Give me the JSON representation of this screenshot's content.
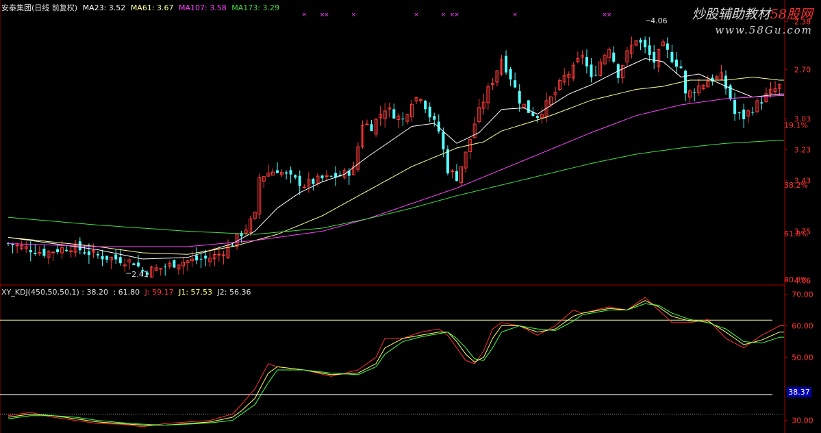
{
  "main_header": {
    "name": "安泰集团(日线 前复权)",
    "ma23": "MA23: 3.52",
    "ma61": "MA61: 3.67",
    "ma107": "MA107: 3.58",
    "ma173": "MA173: 3.29"
  },
  "ind_header": {
    "name": "XY_KDJ(450,50,50,1)",
    "v1": ": 38.20",
    "v2": ": 61.80",
    "j": "J: 59.17",
    "j1": "J1: 57.53",
    "j2": "J2: 56.36"
  },
  "watermark": {
    "line1_a": "炒股辅助教材",
    "line1_b": "58股网",
    "line2": "www.58Gu.com"
  },
  "colors": {
    "up": "#ff3b3b",
    "down": "#54ffff",
    "ma23": "#ffffff",
    "ma61": "#ffff99",
    "ma107": "#ff44ff",
    "ma173": "#44dd44",
    "axis": "#aa0000",
    "axis_text": "#ff3333",
    "k_j": "#ff3030",
    "k_j1": "#ffff66",
    "k_j2": "#44ff44"
  },
  "chart_data": [
    {
      "type": "candlestick",
      "name": "安泰集团(日线 前复权)",
      "y_axis_labels": [
        "4.06",
        "3.75",
        "3.43",
        "3.23",
        "3.03",
        "2.70",
        "2.38"
      ],
      "pct_labels": [
        "80.9%",
        "61.8%",
        "38.2%",
        "19.1%"
      ],
      "price_annotations": {
        "high": "4.06",
        "low": "2.41"
      },
      "ylim": [
        2.36,
        4.12
      ],
      "price_levels": [
        2.38,
        2.7,
        3.03,
        3.23,
        3.43,
        3.75,
        4.06
      ],
      "pct_levels": [
        2.41,
        2.725,
        3.04,
        3.43,
        3.75
      ],
      "close_path": [
        [
          0,
          2.62
        ],
        [
          8,
          2.56
        ],
        [
          14,
          2.6
        ],
        [
          20,
          2.54
        ],
        [
          28,
          2.5
        ],
        [
          30,
          2.44
        ],
        [
          34,
          2.46
        ],
        [
          38,
          2.5
        ],
        [
          44,
          2.52
        ],
        [
          47,
          2.55
        ],
        [
          50,
          2.62
        ],
        [
          53,
          2.72
        ],
        [
          55,
          2.8
        ],
        [
          56,
          3.05
        ],
        [
          58,
          3.08
        ],
        [
          60,
          3.1
        ],
        [
          62,
          3.06
        ],
        [
          66,
          3.0
        ],
        [
          70,
          3.04
        ],
        [
          74,
          3.06
        ],
        [
          77,
          3.1
        ],
        [
          79,
          3.4
        ],
        [
          81,
          3.38
        ],
        [
          84,
          3.5
        ],
        [
          88,
          3.42
        ],
        [
          90,
          3.55
        ],
        [
          92,
          3.58
        ],
        [
          94,
          3.45
        ],
        [
          96,
          3.35
        ],
        [
          98,
          3.1
        ],
        [
          100,
          3.05
        ],
        [
          102,
          3.2
        ],
        [
          104,
          3.4
        ],
        [
          106,
          3.55
        ],
        [
          108,
          3.68
        ],
        [
          110,
          3.82
        ],
        [
          112,
          3.7
        ],
        [
          114,
          3.55
        ],
        [
          116,
          3.48
        ],
        [
          118,
          3.45
        ],
        [
          120,
          3.52
        ],
        [
          122,
          3.6
        ],
        [
          124,
          3.7
        ],
        [
          126,
          3.75
        ],
        [
          128,
          3.85
        ],
        [
          130,
          3.68
        ],
        [
          132,
          3.8
        ],
        [
          134,
          3.9
        ],
        [
          136,
          3.72
        ],
        [
          138,
          3.85
        ],
        [
          140,
          3.95
        ],
        [
          142,
          3.88
        ],
        [
          144,
          3.8
        ],
        [
          146,
          3.9
        ],
        [
          148,
          3.82
        ],
        [
          150,
          3.76
        ],
        [
          151,
          3.58
        ],
        [
          153,
          3.62
        ],
        [
          156,
          3.68
        ],
        [
          159,
          3.7
        ],
        [
          161,
          3.56
        ],
        [
          162,
          3.46
        ],
        [
          164,
          3.44
        ],
        [
          166,
          3.5
        ],
        [
          168,
          3.55
        ],
        [
          170,
          3.6
        ],
        [
          172,
          3.64
        ]
      ],
      "ma_paths": {
        "ma23": [
          [
            0,
            2.66
          ],
          [
            10,
            2.62
          ],
          [
            20,
            2.58
          ],
          [
            30,
            2.52
          ],
          [
            40,
            2.53
          ],
          [
            50,
            2.62
          ],
          [
            55,
            2.7
          ],
          [
            60,
            2.85
          ],
          [
            65,
            2.95
          ],
          [
            70,
            3.02
          ],
          [
            75,
            3.07
          ],
          [
            80,
            3.18
          ],
          [
            90,
            3.38
          ],
          [
            95,
            3.4
          ],
          [
            100,
            3.27
          ],
          [
            105,
            3.34
          ],
          [
            110,
            3.49
          ],
          [
            115,
            3.5
          ],
          [
            118,
            3.46
          ],
          [
            125,
            3.59
          ],
          [
            130,
            3.65
          ],
          [
            136,
            3.74
          ],
          [
            142,
            3.82
          ],
          [
            146,
            3.8
          ],
          [
            150,
            3.7
          ],
          [
            154,
            3.72
          ],
          [
            160,
            3.64
          ],
          [
            166,
            3.57
          ],
          [
            172,
            3.59
          ]
        ],
        "ma61": [
          [
            0,
            2.66
          ],
          [
            20,
            2.6
          ],
          [
            30,
            2.56
          ],
          [
            40,
            2.55
          ],
          [
            50,
            2.6
          ],
          [
            60,
            2.68
          ],
          [
            70,
            2.8
          ],
          [
            80,
            2.96
          ],
          [
            90,
            3.12
          ],
          [
            100,
            3.24
          ],
          [
            106,
            3.28
          ],
          [
            110,
            3.35
          ],
          [
            120,
            3.44
          ],
          [
            130,
            3.55
          ],
          [
            140,
            3.62
          ],
          [
            146,
            3.64
          ],
          [
            152,
            3.68
          ],
          [
            160,
            3.68
          ],
          [
            166,
            3.7
          ],
          [
            172,
            3.68
          ]
        ],
        "ma107": [
          [
            0,
            2.62
          ],
          [
            20,
            2.6
          ],
          [
            40,
            2.6
          ],
          [
            55,
            2.64
          ],
          [
            70,
            2.7
          ],
          [
            80,
            2.78
          ],
          [
            90,
            2.88
          ],
          [
            100,
            2.98
          ],
          [
            110,
            3.1
          ],
          [
            120,
            3.22
          ],
          [
            130,
            3.34
          ],
          [
            140,
            3.45
          ],
          [
            150,
            3.52
          ],
          [
            160,
            3.56
          ],
          [
            172,
            3.58
          ]
        ],
        "ma173": [
          [
            0,
            2.79
          ],
          [
            20,
            2.74
          ],
          [
            40,
            2.7
          ],
          [
            55,
            2.68
          ],
          [
            70,
            2.72
          ],
          [
            80,
            2.78
          ],
          [
            90,
            2.85
          ],
          [
            100,
            2.93
          ],
          [
            110,
            3.0
          ],
          [
            120,
            3.07
          ],
          [
            130,
            3.14
          ],
          [
            140,
            3.2
          ],
          [
            150,
            3.24
          ],
          [
            160,
            3.27
          ],
          [
            172,
            3.29
          ]
        ]
      },
      "signal_marks_x": [
        66,
        70,
        71,
        77,
        91,
        97,
        99,
        100,
        113,
        133,
        134
      ]
    },
    {
      "type": "line",
      "name": "XY_KDJ(450,50,50,1)",
      "y_axis_labels": [
        "70.00",
        "60.00",
        "50.00",
        "30.00"
      ],
      "ylim": [
        26,
        72.5
      ],
      "y_levels": [
        70,
        60,
        50,
        30
      ],
      "hlines": [
        38.2,
        61.8,
        32.0
      ],
      "current_value_label": "38.37",
      "series": [
        {
          "name": "J",
          "points": [
            [
              0,
              31.5
            ],
            [
              5,
              32.5
            ],
            [
              10,
              31
            ],
            [
              15,
              30
            ],
            [
              20,
              29
            ],
            [
              25,
              28.8
            ],
            [
              30,
              28
            ],
            [
              35,
              29
            ],
            [
              40,
              29.5
            ],
            [
              45,
              30
            ],
            [
              50,
              32
            ],
            [
              52,
              35
            ],
            [
              55,
              40
            ],
            [
              58,
              48
            ],
            [
              60,
              47
            ],
            [
              66,
              46
            ],
            [
              72,
              44
            ],
            [
              78,
              46
            ],
            [
              82,
              50
            ],
            [
              84,
              56
            ],
            [
              88,
              56
            ],
            [
              92,
              58
            ],
            [
              96,
              59
            ],
            [
              98,
              57
            ],
            [
              100,
              53
            ],
            [
              102,
              49
            ],
            [
              104,
              48
            ],
            [
              106,
              52
            ],
            [
              108,
              59
            ],
            [
              110,
              61
            ],
            [
              114,
              60
            ],
            [
              118,
              57
            ],
            [
              122,
              60
            ],
            [
              126,
              65
            ],
            [
              128,
              64
            ],
            [
              134,
              66
            ],
            [
              138,
              65
            ],
            [
              142,
              69
            ],
            [
              145,
              65
            ],
            [
              148,
              61
            ],
            [
              152,
              61
            ],
            [
              156,
              62
            ],
            [
              160,
              56
            ],
            [
              164,
              53
            ],
            [
              168,
              57
            ],
            [
              172,
              60
            ]
          ]
        },
        {
          "name": "J1",
          "points": [
            [
              0,
              31
            ],
            [
              5,
              32
            ],
            [
              10,
              31.5
            ],
            [
              15,
              30.5
            ],
            [
              20,
              29.5
            ],
            [
              25,
              29
            ],
            [
              30,
              28.5
            ],
            [
              35,
              28.5
            ],
            [
              40,
              29
            ],
            [
              45,
              29.5
            ],
            [
              50,
              31
            ],
            [
              52,
              33
            ],
            [
              55,
              37
            ],
            [
              58,
              45
            ],
            [
              60,
              47
            ],
            [
              66,
              46
            ],
            [
              72,
              44.5
            ],
            [
              78,
              45
            ],
            [
              82,
              48
            ],
            [
              84,
              53
            ],
            [
              88,
              56
            ],
            [
              92,
              57
            ],
            [
              96,
              58
            ],
            [
              98,
              58
            ],
            [
              100,
              55
            ],
            [
              102,
              51
            ],
            [
              104,
              48.5
            ],
            [
              106,
              50
            ],
            [
              108,
              56
            ],
            [
              110,
              60
            ],
            [
              114,
              60
            ],
            [
              118,
              58
            ],
            [
              122,
              59
            ],
            [
              126,
              63
            ],
            [
              128,
              64
            ],
            [
              134,
              65.5
            ],
            [
              138,
              65
            ],
            [
              142,
              68
            ],
            [
              145,
              66
            ],
            [
              148,
              63
            ],
            [
              152,
              61.5
            ],
            [
              156,
              61.5
            ],
            [
              160,
              58
            ],
            [
              164,
              54
            ],
            [
              168,
              55.5
            ],
            [
              172,
              58
            ]
          ]
        },
        {
          "name": "J2",
          "points": [
            [
              0,
              30.5
            ],
            [
              5,
              31.5
            ],
            [
              10,
              31.5
            ],
            [
              15,
              31
            ],
            [
              20,
              30
            ],
            [
              25,
              29.3
            ],
            [
              30,
              28.8
            ],
            [
              35,
              28.5
            ],
            [
              40,
              28.8
            ],
            [
              45,
              29.2
            ],
            [
              50,
              30
            ],
            [
              52,
              32
            ],
            [
              55,
              35
            ],
            [
              58,
              42
            ],
            [
              60,
              46
            ],
            [
              66,
              46
            ],
            [
              72,
              45
            ],
            [
              78,
              44.5
            ],
            [
              82,
              47
            ],
            [
              84,
              51
            ],
            [
              88,
              55
            ],
            [
              92,
              56.5
            ],
            [
              96,
              57.5
            ],
            [
              98,
              58
            ],
            [
              100,
              56
            ],
            [
              102,
              53
            ],
            [
              104,
              49.5
            ],
            [
              106,
              49
            ],
            [
              108,
              53
            ],
            [
              110,
              58
            ],
            [
              114,
              60
            ],
            [
              118,
              59
            ],
            [
              122,
              58.5
            ],
            [
              126,
              61.5
            ],
            [
              128,
              63.5
            ],
            [
              134,
              65
            ],
            [
              138,
              65
            ],
            [
              142,
              67
            ],
            [
              145,
              66.5
            ],
            [
              148,
              64
            ],
            [
              152,
              62
            ],
            [
              156,
              61
            ],
            [
              160,
              59
            ],
            [
              164,
              55
            ],
            [
              168,
              54.5
            ],
            [
              172,
              56.4
            ]
          ]
        }
      ]
    }
  ]
}
